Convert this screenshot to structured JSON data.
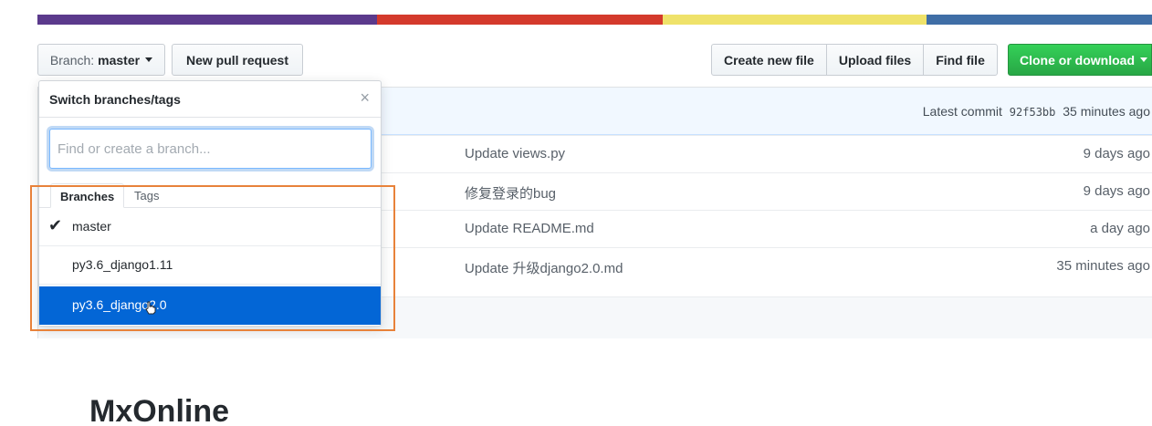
{
  "colors": {
    "lang_bar": [
      "#5b3a8c",
      "#d43a2c",
      "#efe26a",
      "#3f6ea6"
    ],
    "accent": "#0366d6",
    "clone_green": "#2cbe4e",
    "highlight": "#e8823a"
  },
  "toolbar": {
    "branch_prefix": "Branch:",
    "branch_name": "master",
    "new_pull_request": "New pull request",
    "create_new_file": "Create new file",
    "upload_files": "Upload files",
    "find_file": "Find file",
    "clone_or_download": "Clone or download"
  },
  "commit_bar": {
    "prefix": "Latest commit",
    "sha": "92f53bb",
    "age": "35 minutes ago"
  },
  "files": [
    {
      "message": "Update views.py",
      "age": "9 days ago"
    },
    {
      "message": "修复登录的bug",
      "age": "9 days ago"
    },
    {
      "message": "Update README.md",
      "age": "a day ago"
    },
    {
      "message": "Update 升级django2.0.md",
      "age": "35 minutes ago"
    }
  ],
  "dropdown": {
    "title": "Switch branches/tags",
    "close_glyph": "×",
    "search_placeholder": "Find or create a branch...",
    "tabs": [
      "Branches",
      "Tags"
    ],
    "check_glyph": "✔",
    "items": [
      {
        "label": "master",
        "checked": true
      },
      {
        "label": "py3.6_django1.11"
      },
      {
        "label": "py3.6_django2.0",
        "selected": true
      }
    ]
  },
  "readme": {
    "title": "MxOnline"
  }
}
